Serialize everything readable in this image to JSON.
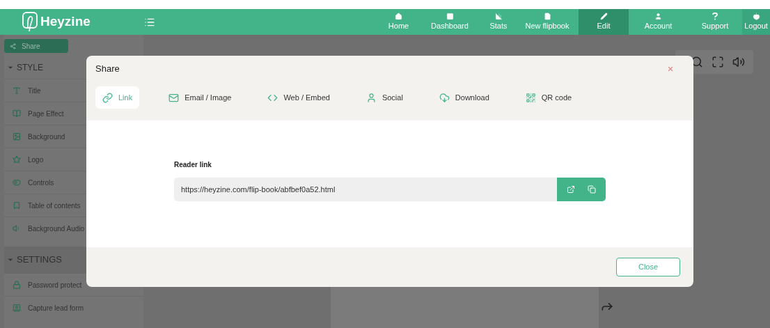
{
  "header": {
    "brand": "Heyzine",
    "nav": [
      {
        "label": "Home",
        "selected": false
      },
      {
        "label": "Dashboard",
        "selected": false
      },
      {
        "label": "Stats",
        "selected": false
      },
      {
        "label": "New flipbook",
        "selected": false
      },
      {
        "label": "Edit",
        "selected": true
      },
      {
        "label": "Account",
        "selected": false
      },
      {
        "label": "Support",
        "selected": false
      },
      {
        "label": "Logout",
        "selected": false,
        "kind": "logout"
      }
    ]
  },
  "sidebar": {
    "share_button": "Share",
    "sections": [
      {
        "title": "STYLE",
        "expanded": true,
        "items": [
          "Title",
          "Page Effect",
          "Background",
          "Logo",
          "Controls",
          "Table of contents",
          "Background Audio"
        ]
      },
      {
        "title": "SETTINGS",
        "expanded": true,
        "items": [
          "Password protect",
          "Capture lead form"
        ]
      }
    ]
  },
  "dialog": {
    "title": "Share",
    "tabs": [
      {
        "label": "Link",
        "selected": true
      },
      {
        "label": "Email / Image",
        "selected": false
      },
      {
        "label": "Web / Embed",
        "selected": false
      },
      {
        "label": "Social",
        "selected": false
      },
      {
        "label": "Download",
        "selected": false
      },
      {
        "label": "QR code",
        "selected": false
      }
    ],
    "field_label": "Reader link",
    "link": "https://heyzine.com/flip-book/abfbef0a52.html",
    "close_button": "Close"
  }
}
